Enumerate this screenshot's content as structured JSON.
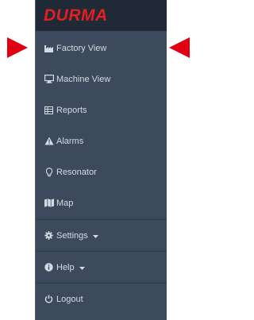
{
  "brand": {
    "logo_text": "DURMA",
    "logo_color": "#e31e24"
  },
  "menu": {
    "items": [
      {
        "label": "Factory View",
        "icon": "factory-icon"
      },
      {
        "label": "Machine View",
        "icon": "monitor-icon"
      },
      {
        "label": "Reports",
        "icon": "table-icon"
      },
      {
        "label": "Alarms",
        "icon": "warning-icon"
      },
      {
        "label": "Resonator",
        "icon": "lightbulb-icon"
      },
      {
        "label": "Map",
        "icon": "map-icon"
      },
      {
        "label": "Settings",
        "icon": "gear-icon",
        "dropdown": true
      },
      {
        "label": "Help",
        "icon": "info-icon",
        "dropdown": true
      },
      {
        "label": "Logout",
        "icon": "power-icon"
      }
    ]
  },
  "colors": {
    "sidebar_bg": "#3c4a5b",
    "header_bg": "#1f2a36",
    "text": "#d5dbe2",
    "highlight_arrows": "#e00012"
  }
}
